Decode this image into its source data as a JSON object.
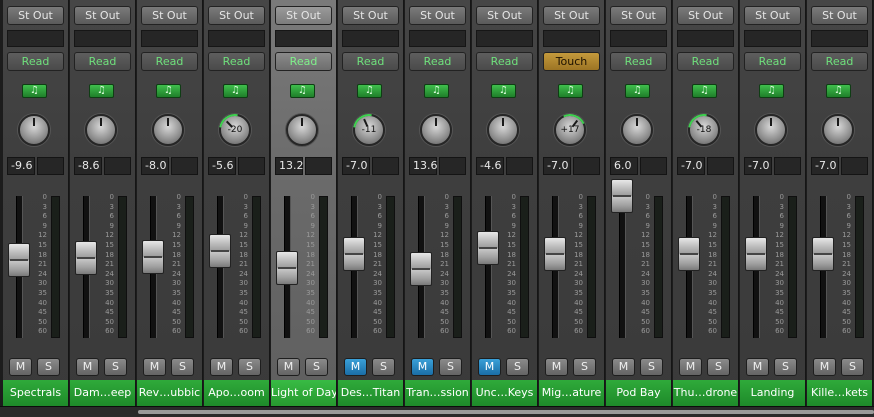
{
  "colors": {
    "read_text": "#6fe07c",
    "touch_bg": "#c49a3c",
    "name_bg": "#1e8a2a",
    "mute_active": "#2a88c6"
  },
  "labels": {
    "mute": "M",
    "solo": "S",
    "instrument_icon": "♫"
  },
  "channels": [
    {
      "output": "St Out",
      "automation": "Read",
      "pan": null,
      "pan_level": 0,
      "volume": "-9.6",
      "fader_db": -9.6,
      "mute": false,
      "name": "Spectrals",
      "selected": false
    },
    {
      "output": "St Out",
      "automation": "Read",
      "pan": null,
      "pan_level": 0,
      "volume": "-8.6",
      "fader_db": -8.6,
      "mute": false,
      "name": "Dam…eep",
      "selected": false
    },
    {
      "output": "St Out",
      "automation": "Read",
      "pan": null,
      "pan_level": 0,
      "volume": "-8.0",
      "fader_db": -8.0,
      "mute": false,
      "name": "Rev…ubbic",
      "selected": false
    },
    {
      "output": "St Out",
      "automation": "Read",
      "pan": "-20",
      "pan_level": -20,
      "volume": "-5.6",
      "fader_db": -5.6,
      "mute": false,
      "name": "Apo…oom",
      "selected": false
    },
    {
      "output": "St Out",
      "automation": "Read",
      "pan": null,
      "pan_level": 0,
      "volume": "13.2",
      "fader_db": -13.2,
      "mute": false,
      "name": "Light of Day",
      "selected": true
    },
    {
      "output": "St Out",
      "automation": "Read",
      "pan": "-11",
      "pan_level": -11,
      "volume": "-7.0",
      "fader_db": -7.0,
      "mute": true,
      "name": "Des…Titan",
      "selected": false
    },
    {
      "output": "St Out",
      "automation": "Read",
      "pan": null,
      "pan_level": 0,
      "volume": "13.6",
      "fader_db": -13.6,
      "mute": true,
      "name": "Tran…ssion",
      "selected": false
    },
    {
      "output": "St Out",
      "automation": "Read",
      "pan": null,
      "pan_level": 0,
      "volume": "-4.6",
      "fader_db": -4.6,
      "mute": true,
      "name": "Unc…Keys",
      "selected": false
    },
    {
      "output": "St Out",
      "automation": "Touch",
      "pan": "+17",
      "pan_level": 17,
      "volume": "-7.0",
      "fader_db": -7.0,
      "mute": false,
      "name": "Mig…ature",
      "selected": false
    },
    {
      "output": "St Out",
      "automation": "Read",
      "pan": null,
      "pan_level": 0,
      "volume": "6.0",
      "fader_db": 6.0,
      "mute": false,
      "name": "Pod Bay",
      "selected": false
    },
    {
      "output": "St Out",
      "automation": "Read",
      "pan": "-18",
      "pan_level": -18,
      "volume": "-7.0",
      "fader_db": -7.0,
      "mute": false,
      "name": "Thu…drone",
      "selected": false
    },
    {
      "output": "St Out",
      "automation": "Read",
      "pan": null,
      "pan_level": 0,
      "volume": "-7.0",
      "fader_db": -7.0,
      "mute": false,
      "name": "Landing",
      "selected": false
    },
    {
      "output": "St Out",
      "automation": "Read",
      "pan": null,
      "pan_level": 0,
      "volume": "-7.0",
      "fader_db": -7.0,
      "mute": false,
      "name": "Kille…kets",
      "selected": false
    }
  ],
  "scale_ticks": [
    "0",
    "3",
    "6",
    "9",
    "12",
    "15",
    "18",
    "21",
    "24",
    "30",
    "35",
    "40",
    "45",
    "50",
    "60"
  ]
}
